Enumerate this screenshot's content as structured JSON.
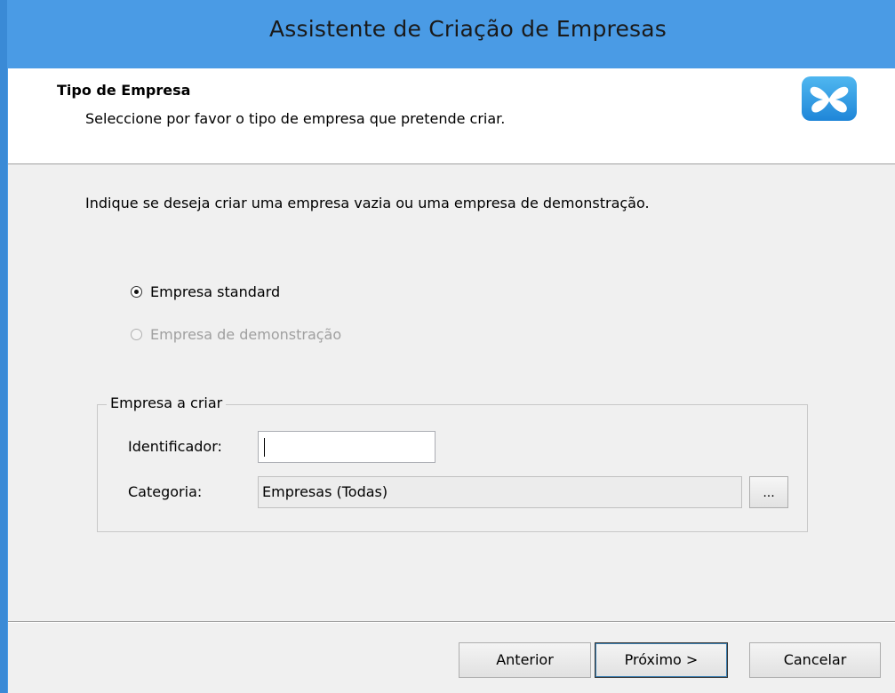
{
  "window": {
    "title": "Assistente de Criação de Empresas"
  },
  "header": {
    "title": "Tipo de Empresa",
    "subtitle": "Seleccione por favor o tipo de empresa que pretende criar.",
    "logo_icon": "butterfly-icon"
  },
  "body": {
    "intro": "Indique se deseja criar uma empresa vazia ou uma empresa de demonstração.",
    "options": [
      {
        "label": "Empresa standard",
        "checked": true,
        "enabled": true
      },
      {
        "label": "Empresa de demonstração",
        "checked": false,
        "enabled": false
      }
    ],
    "group": {
      "legend": "Empresa a criar",
      "identifier_label": "Identificador:",
      "identifier_value": "",
      "category_label": "Categoria:",
      "category_value": "Empresas (Todas)",
      "browse_label": "..."
    }
  },
  "footer": {
    "back_label": "Anterior",
    "next_label": "Próximo >",
    "cancel_label": "Cancelar"
  },
  "colors": {
    "titlebar": "#4a9be5",
    "client_bg": "#f0f0f0",
    "header_bg": "#ffffff",
    "logo": "#2a93e0"
  }
}
